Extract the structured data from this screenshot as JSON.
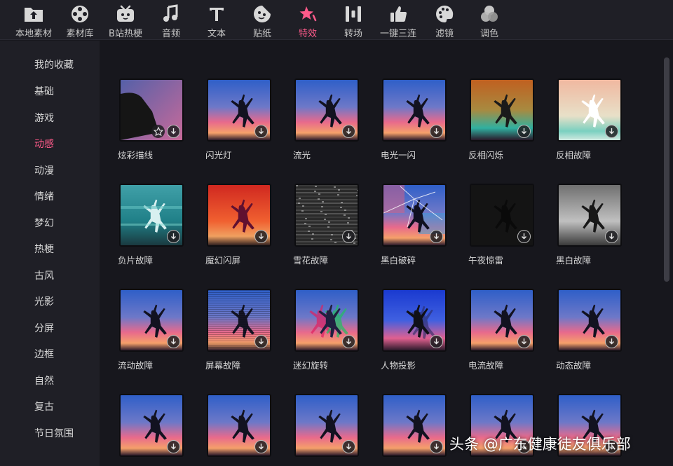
{
  "toolbar": {
    "items": [
      {
        "label": "本地素材",
        "icon": "upload-folder-icon"
      },
      {
        "label": "素材库",
        "icon": "film-reel-icon"
      },
      {
        "label": "B站热梗",
        "icon": "bilibili-tv-icon"
      },
      {
        "label": "音频",
        "icon": "music-note-icon"
      },
      {
        "label": "文本",
        "icon": "text-t-icon"
      },
      {
        "label": "贴纸",
        "icon": "sticker-icon"
      },
      {
        "label": "特效",
        "icon": "star-effect-icon"
      },
      {
        "label": "转场",
        "icon": "transition-bars-icon"
      },
      {
        "label": "一键三连",
        "icon": "thumbs-up-icon"
      },
      {
        "label": "滤镜",
        "icon": "palette-icon"
      },
      {
        "label": "调色",
        "icon": "color-circles-icon"
      }
    ],
    "active_index": 6
  },
  "sidebar": {
    "items": [
      {
        "label": "我的收藏"
      },
      {
        "label": "基础"
      },
      {
        "label": "游戏"
      },
      {
        "label": "动感"
      },
      {
        "label": "动漫"
      },
      {
        "label": "情绪"
      },
      {
        "label": "梦幻"
      },
      {
        "label": "热梗"
      },
      {
        "label": "古风"
      },
      {
        "label": "光影"
      },
      {
        "label": "分屏"
      },
      {
        "label": "边框"
      },
      {
        "label": "自然"
      },
      {
        "label": "复古"
      },
      {
        "label": "节日氛围"
      }
    ],
    "active_index": 3
  },
  "effects": [
    {
      "label": "炫彩描线",
      "style": "outline"
    },
    {
      "label": "闪光灯",
      "style": "normal"
    },
    {
      "label": "流光",
      "style": "normal"
    },
    {
      "label": "电光一闪",
      "style": "normal"
    },
    {
      "label": "反相闪烁",
      "style": "invert"
    },
    {
      "label": "反相故障",
      "style": "whiteinv"
    },
    {
      "label": "负片故障",
      "style": "negative"
    },
    {
      "label": "魔幻闪屏",
      "style": "red"
    },
    {
      "label": "雪花故障",
      "style": "snow"
    },
    {
      "label": "黑白破碎",
      "style": "broken"
    },
    {
      "label": "午夜惊雷",
      "style": "dark"
    },
    {
      "label": "黑白故障",
      "style": "bw"
    },
    {
      "label": "流动故障",
      "style": "normal"
    },
    {
      "label": "屏幕故障",
      "style": "lines"
    },
    {
      "label": "迷幻旋转",
      "style": "rgb"
    },
    {
      "label": "人物投影",
      "style": "blue"
    },
    {
      "label": "电流故障",
      "style": "normal"
    },
    {
      "label": "动态故障",
      "style": "normal"
    },
    {
      "label": "",
      "style": "normal"
    },
    {
      "label": "",
      "style": "normal"
    },
    {
      "label": "",
      "style": "normal"
    },
    {
      "label": "",
      "style": "normal"
    },
    {
      "label": "",
      "style": "normal"
    },
    {
      "label": "",
      "style": "normal"
    }
  ],
  "watermark": "头条 @广东健康徒友俱乐部",
  "colors": {
    "accent": "#ff5a8a",
    "toolbar_bg": "#1f1f26",
    "content_bg": "#17171d"
  }
}
